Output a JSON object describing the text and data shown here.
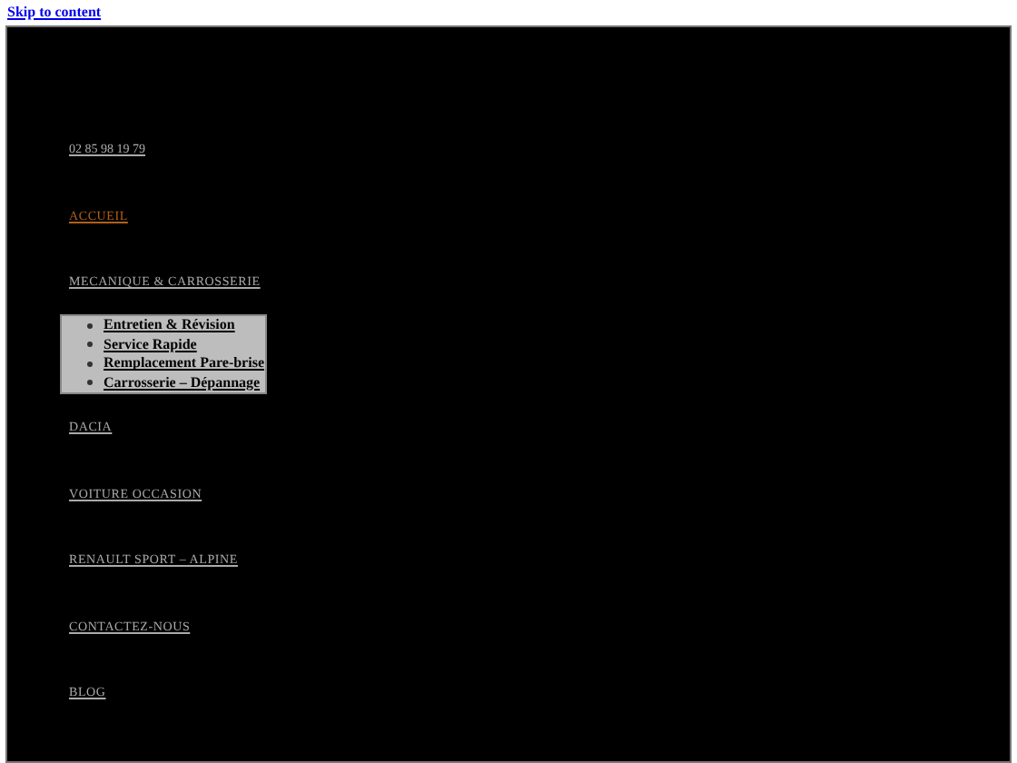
{
  "skip_link": "Skip to content",
  "phone": "02 85 98 19 79",
  "menu": [
    {
      "label": "ACCUEIL",
      "selected": true
    },
    {
      "label": "MECANIQUE & CARROSSERIE",
      "selected": false,
      "children": [
        {
          "label": "Entretien & Révision"
        },
        {
          "label": "Service Rapide"
        },
        {
          "label": "Remplacement Pare-brise"
        },
        {
          "label": "Carrosserie – Dépannage"
        }
      ]
    },
    {
      "label": "DACIA",
      "selected": false
    },
    {
      "label": "VOITURE OCCASION",
      "selected": false
    },
    {
      "label": "RENAULT SPORT – ALPINE",
      "selected": false
    },
    {
      "label": "CONTACTEZ-NOUS",
      "selected": false
    },
    {
      "label": "BLOG",
      "selected": false
    }
  ]
}
